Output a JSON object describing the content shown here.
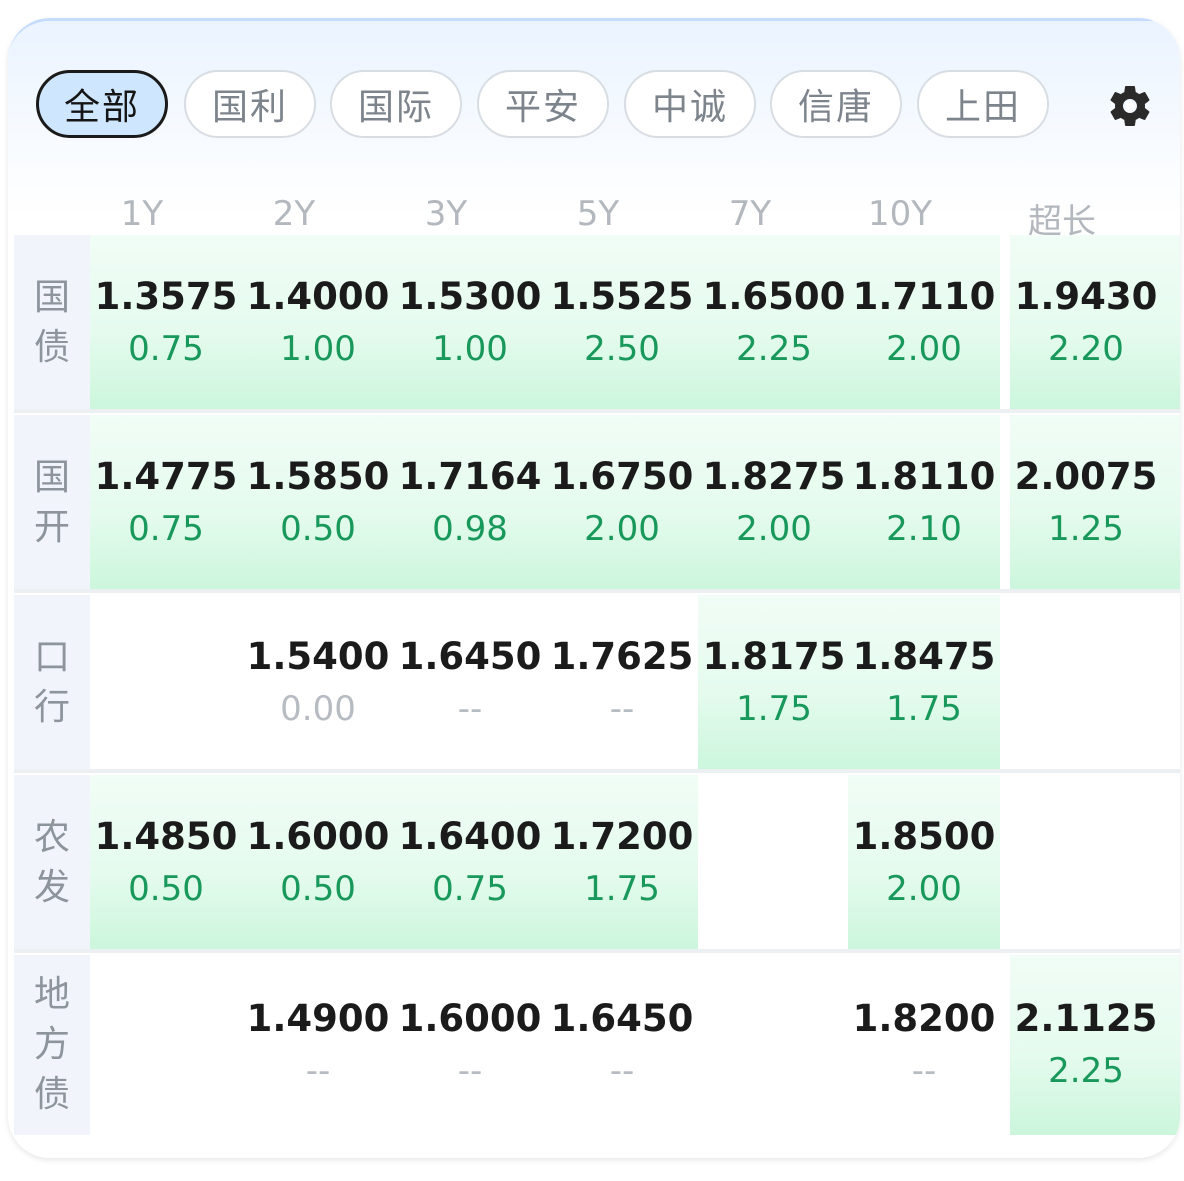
{
  "tabs": [
    "全部",
    "国利",
    "国际",
    "平安",
    "中诚",
    "信唐",
    "上田"
  ],
  "active_tab": 0,
  "settings_icon": "gear-icon",
  "columns": [
    "1Y",
    "2Y",
    "3Y",
    "5Y",
    "7Y",
    "10Y",
    "超长"
  ],
  "rows": [
    {
      "label": [
        "国",
        "债"
      ],
      "cells": [
        {
          "rate": "1.3575",
          "change": "0.75"
        },
        {
          "rate": "1.4000",
          "change": "1.00"
        },
        {
          "rate": "1.5300",
          "change": "1.00"
        },
        {
          "rate": "1.5525",
          "change": "2.50"
        },
        {
          "rate": "1.6500",
          "change": "2.25"
        },
        {
          "rate": "1.7110",
          "change": "2.00"
        },
        {
          "rate": "1.9430",
          "change": "2.20"
        }
      ]
    },
    {
      "label": [
        "国",
        "开"
      ],
      "cells": [
        {
          "rate": "1.4775",
          "change": "0.75"
        },
        {
          "rate": "1.5850",
          "change": "0.50"
        },
        {
          "rate": "1.7164",
          "change": "0.98"
        },
        {
          "rate": "1.6750",
          "change": "2.00"
        },
        {
          "rate": "1.8275",
          "change": "2.00"
        },
        {
          "rate": "1.8110",
          "change": "2.10"
        },
        {
          "rate": "2.0075",
          "change": "1.25"
        }
      ]
    },
    {
      "label": [
        "口",
        "行"
      ],
      "cells": [
        null,
        {
          "rate": "1.5400",
          "change": "0.00"
        },
        {
          "rate": "1.6450",
          "change": "--"
        },
        {
          "rate": "1.7625",
          "change": "--"
        },
        {
          "rate": "1.8175",
          "change": "1.75"
        },
        {
          "rate": "1.8475",
          "change": "1.75"
        },
        null
      ]
    },
    {
      "label": [
        "农",
        "发"
      ],
      "cells": [
        {
          "rate": "1.4850",
          "change": "0.50"
        },
        {
          "rate": "1.6000",
          "change": "0.50"
        },
        {
          "rate": "1.6400",
          "change": "0.75"
        },
        {
          "rate": "1.7200",
          "change": "1.75"
        },
        null,
        {
          "rate": "1.8500",
          "change": "2.00"
        },
        null
      ]
    },
    {
      "label": [
        "地",
        "方",
        "债"
      ],
      "cells": [
        null,
        {
          "rate": "1.4900",
          "change": "--"
        },
        {
          "rate": "1.6000",
          "change": "--"
        },
        {
          "rate": "1.6450",
          "change": "--"
        },
        null,
        {
          "rate": "1.8200",
          "change": "--"
        },
        {
          "rate": "2.1125",
          "change": "2.25"
        }
      ]
    }
  ],
  "colors": {
    "positive": "#18985a",
    "neutral": "#b7bcc2",
    "highlight": "#d8f8e6",
    "active_tab_bg": "#cfe6ff"
  }
}
